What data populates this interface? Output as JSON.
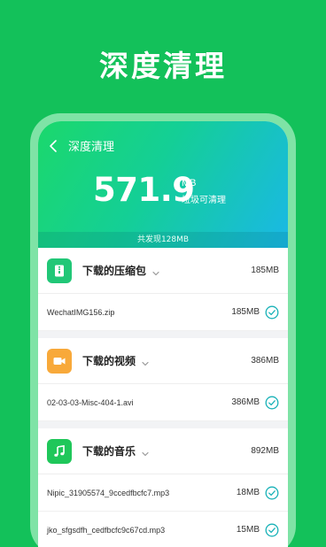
{
  "promo_title": "深度清理",
  "header": {
    "title": "深度清理",
    "back_icon": "back-arrow-icon",
    "size_value": "571.9",
    "size_unit": "MB",
    "size_caption": "垃圾可清理",
    "found_text": "共发现128MB"
  },
  "groups": [
    {
      "title": "下载的压缩包",
      "size": "185MB",
      "icon": "archive-icon",
      "color": "#21c777",
      "files": [
        {
          "name": "WechatIMG156.zip",
          "size": "185MB",
          "checked": true
        }
      ]
    },
    {
      "title": "下载的视频",
      "size": "386MB",
      "icon": "video-camera-icon",
      "color": "#f8a93a",
      "files": [
        {
          "name": "02-03-03-Misc-404-1.avi",
          "size": "386MB",
          "checked": true
        }
      ]
    },
    {
      "title": "下载的音乐",
      "size": "892MB",
      "icon": "music-note-icon",
      "color": "#1fc75a",
      "files": [
        {
          "name": "Nipic_31905574_9ccedfbcfc7.mp3",
          "size": "18MB",
          "checked": true
        },
        {
          "name": "jko_sfgsdfh_cedfbcfc9c67cd.mp3",
          "size": "15MB",
          "checked": true
        }
      ]
    }
  ],
  "colors": {
    "background": "#13c15a",
    "check": "#1ab2b8"
  }
}
